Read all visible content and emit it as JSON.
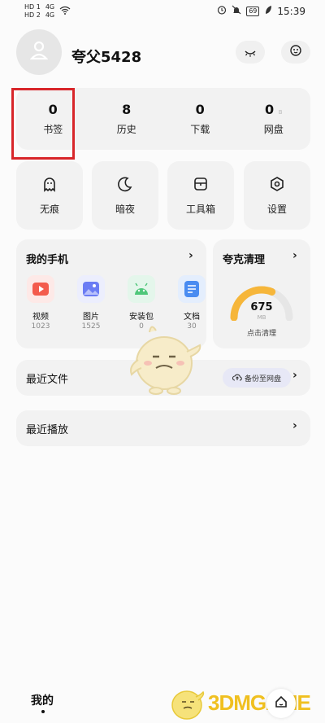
{
  "status_bar": {
    "left_labels": [
      "HD 1",
      "4G",
      "HD 2",
      "4G"
    ],
    "battery": "69",
    "time": "15:39"
  },
  "profile": {
    "username": "夸父5428",
    "icons": [
      "avatar-icon",
      "eye-closed-icon",
      "face-icon"
    ]
  },
  "stats": [
    {
      "value": "0",
      "label": "书签"
    },
    {
      "value": "8",
      "label": "历史"
    },
    {
      "value": "0",
      "label": "下载"
    },
    {
      "value": "0",
      "sub": "B",
      "label": "网盘"
    }
  ],
  "tools": [
    {
      "label": "无痕",
      "icon": "ghost-icon"
    },
    {
      "label": "暗夜",
      "icon": "moon-icon"
    },
    {
      "label": "工具箱",
      "icon": "toolbox-icon"
    },
    {
      "label": "设置",
      "icon": "settings-icon"
    }
  ],
  "my_phone": {
    "title": "我的手机",
    "files": [
      {
        "name": "视频",
        "count": "1023",
        "color": "#f35b4d"
      },
      {
        "name": "图片",
        "count": "1525",
        "color": "#6b7cf4"
      },
      {
        "name": "安装包",
        "count": "0",
        "color": "#4fc77a"
      },
      {
        "name": "文档",
        "count": "30",
        "color": "#4a8cf1"
      }
    ]
  },
  "cleaner": {
    "title": "夸克清理",
    "value": "675",
    "unit": "MB",
    "link": "点击清理",
    "gauge_fraction": 0.62,
    "colors": {
      "arc": "#f6b63a",
      "track": "#e6e6e6"
    }
  },
  "recent_files": {
    "title": "最近文件",
    "backup_label": "备份至网盘"
  },
  "recent_play": {
    "title": "最近播放"
  },
  "bottom": {
    "tab": "我的",
    "watermark": "3DMGAME"
  }
}
